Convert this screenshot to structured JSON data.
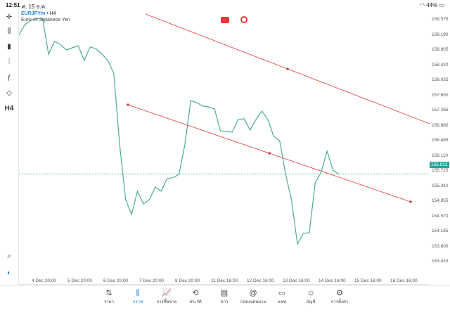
{
  "status": {
    "time": "12:51",
    "date": "ศ. 15 ธ.ค.",
    "battery": "44%"
  },
  "symbol": {
    "name": "EURJPYm",
    "timeframe": "• H4",
    "description": "Euro vs Japanese Yen"
  },
  "toolbar": {
    "h4_label": "H4"
  },
  "y_axis_ticks": [
    "159.575",
    "159.190",
    "158.805",
    "158.420",
    "158.035",
    "157.650",
    "157.265",
    "156.880",
    "156.495",
    "156.110",
    "155.725",
    "155.340",
    "154.955",
    "154.570",
    "154.185",
    "153.800",
    "153.415"
  ],
  "current_price": "155.912",
  "x_axis_ticks": [
    "4 Dec 20:00",
    "5 Dec 20:00",
    "6 Dec 20:00",
    "7 Dec 20:00",
    "8 Dec 20:00",
    "11 Dec 16:00",
    "12 Dec 16:00",
    "13 Dec 16:00",
    "14 Dec 16:00",
    "15 Dec 16:00",
    "16 Dec 16:00"
  ],
  "tabs": [
    {
      "label": "ราคา",
      "icon": "⇅"
    },
    {
      "label": "กราฟ",
      "icon": "⫼"
    },
    {
      "label": "การซื้อขาย",
      "icon": "📈"
    },
    {
      "label": "ประวัติ",
      "icon": "⟲"
    },
    {
      "label": "ข่าว",
      "icon": "▤"
    },
    {
      "label": "กล่องจดหมาย",
      "icon": "@"
    },
    {
      "label": "แชท",
      "icon": "▭"
    },
    {
      "label": "บัญชี",
      "icon": "☺"
    },
    {
      "label": "การตั้งค่า",
      "icon": "⚙"
    }
  ],
  "chart_data": {
    "type": "line",
    "series": [
      {
        "color": "#4caf85",
        "values": [
          159.2,
          159.45,
          159.55,
          159.6,
          159.58,
          158.75,
          159.05,
          158.98,
          158.85,
          158.9,
          158.95,
          158.6,
          158.92,
          158.88,
          158.75,
          158.6,
          158.3,
          156.6,
          155.3,
          154.95,
          155.5,
          155.2,
          155.3,
          155.6,
          155.5,
          155.8,
          155.82,
          155.9,
          156.6,
          157.65,
          157.6,
          157.52,
          157.5,
          157.45,
          156.93,
          156.92,
          156.9,
          157.2,
          157.22,
          156.95,
          157.2,
          157.4,
          157.2,
          156.8,
          156.7,
          155.9,
          155.3,
          154.25,
          154.5,
          154.52,
          155.7,
          155.95,
          156.45,
          156.0,
          155.9
        ]
      }
    ],
    "current_price_line": 155.912,
    "channel_lines": [
      {
        "start": 159.7,
        "end": 157.1,
        "color": "#e53935"
      },
      {
        "start": 157.55,
        "end": 155.25,
        "color": "#e53935"
      }
    ],
    "ylim": [
      153.3,
      159.8
    ]
  }
}
